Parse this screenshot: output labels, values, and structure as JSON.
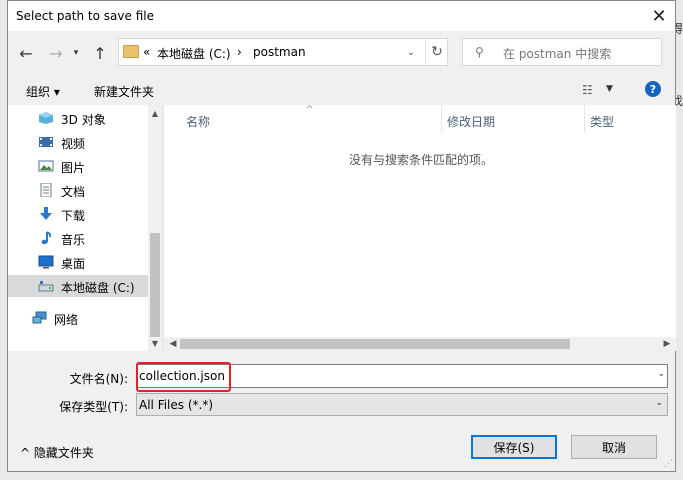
{
  "dialog": {
    "title": "Select path to save file"
  },
  "backdrop": {
    "right_text_1": "得",
    "right_text_2": "找"
  },
  "address": {
    "crumb_prefix": "«",
    "crumb_drive": "本地磁盘 (C:)",
    "crumb_sep": "›",
    "crumb_folder": "postman"
  },
  "search": {
    "placeholder": "在 postman 中搜索"
  },
  "toolbar": {
    "organize": "组织 ▾",
    "new_folder": "新建文件夹",
    "help": "?"
  },
  "nav": {
    "items": [
      {
        "label": "3D 对象",
        "icon": "3d-objects-icon"
      },
      {
        "label": "视频",
        "icon": "video-icon"
      },
      {
        "label": "图片",
        "icon": "pictures-icon"
      },
      {
        "label": "文档",
        "icon": "documents-icon"
      },
      {
        "label": "下载",
        "icon": "downloads-icon"
      },
      {
        "label": "音乐",
        "icon": "music-icon"
      },
      {
        "label": "桌面",
        "icon": "desktop-icon"
      },
      {
        "label": "本地磁盘 (C:)",
        "icon": "drive-icon",
        "selected": true
      },
      {
        "label": "网络",
        "icon": "network-icon"
      }
    ]
  },
  "filelist": {
    "columns": [
      "名称",
      "修改日期",
      "类型"
    ],
    "empty_message": "没有与搜索条件匹配的项。"
  },
  "form": {
    "filename_label": "文件名(N):",
    "filename_value": "collection.json",
    "filetype_label": "保存类型(T):",
    "filetype_value": "All Files (*.*)"
  },
  "footer": {
    "hide_folders": "^ 隐藏文件夹",
    "save": "保存(S)",
    "cancel": "取消"
  },
  "colors": {
    "accent": "#0078d7",
    "highlight": "#e8202a",
    "help": "#1565c0"
  }
}
